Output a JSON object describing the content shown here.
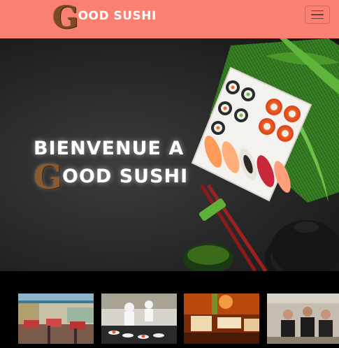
{
  "navbar": {
    "brand_initial": "G",
    "brand_rest": "OOD SUSHI",
    "toggler_icon": "hamburger-menu-icon"
  },
  "hero": {
    "welcome_text": "BIENVENUE A",
    "name_initial": "G",
    "name_rest": "OOD SUSHI"
  },
  "gallery": {
    "thumbnails": [
      {
        "subject": "restaurant-dining-room"
      },
      {
        "subject": "sushi-conveyor-chefs"
      },
      {
        "subject": "orange-lounge-seating"
      },
      {
        "subject": "chefs-team"
      }
    ]
  },
  "colors": {
    "navbar_bg": "#fa8072",
    "brand_wood": "#7a4a22",
    "hero_bg": "#2a2a2a"
  }
}
